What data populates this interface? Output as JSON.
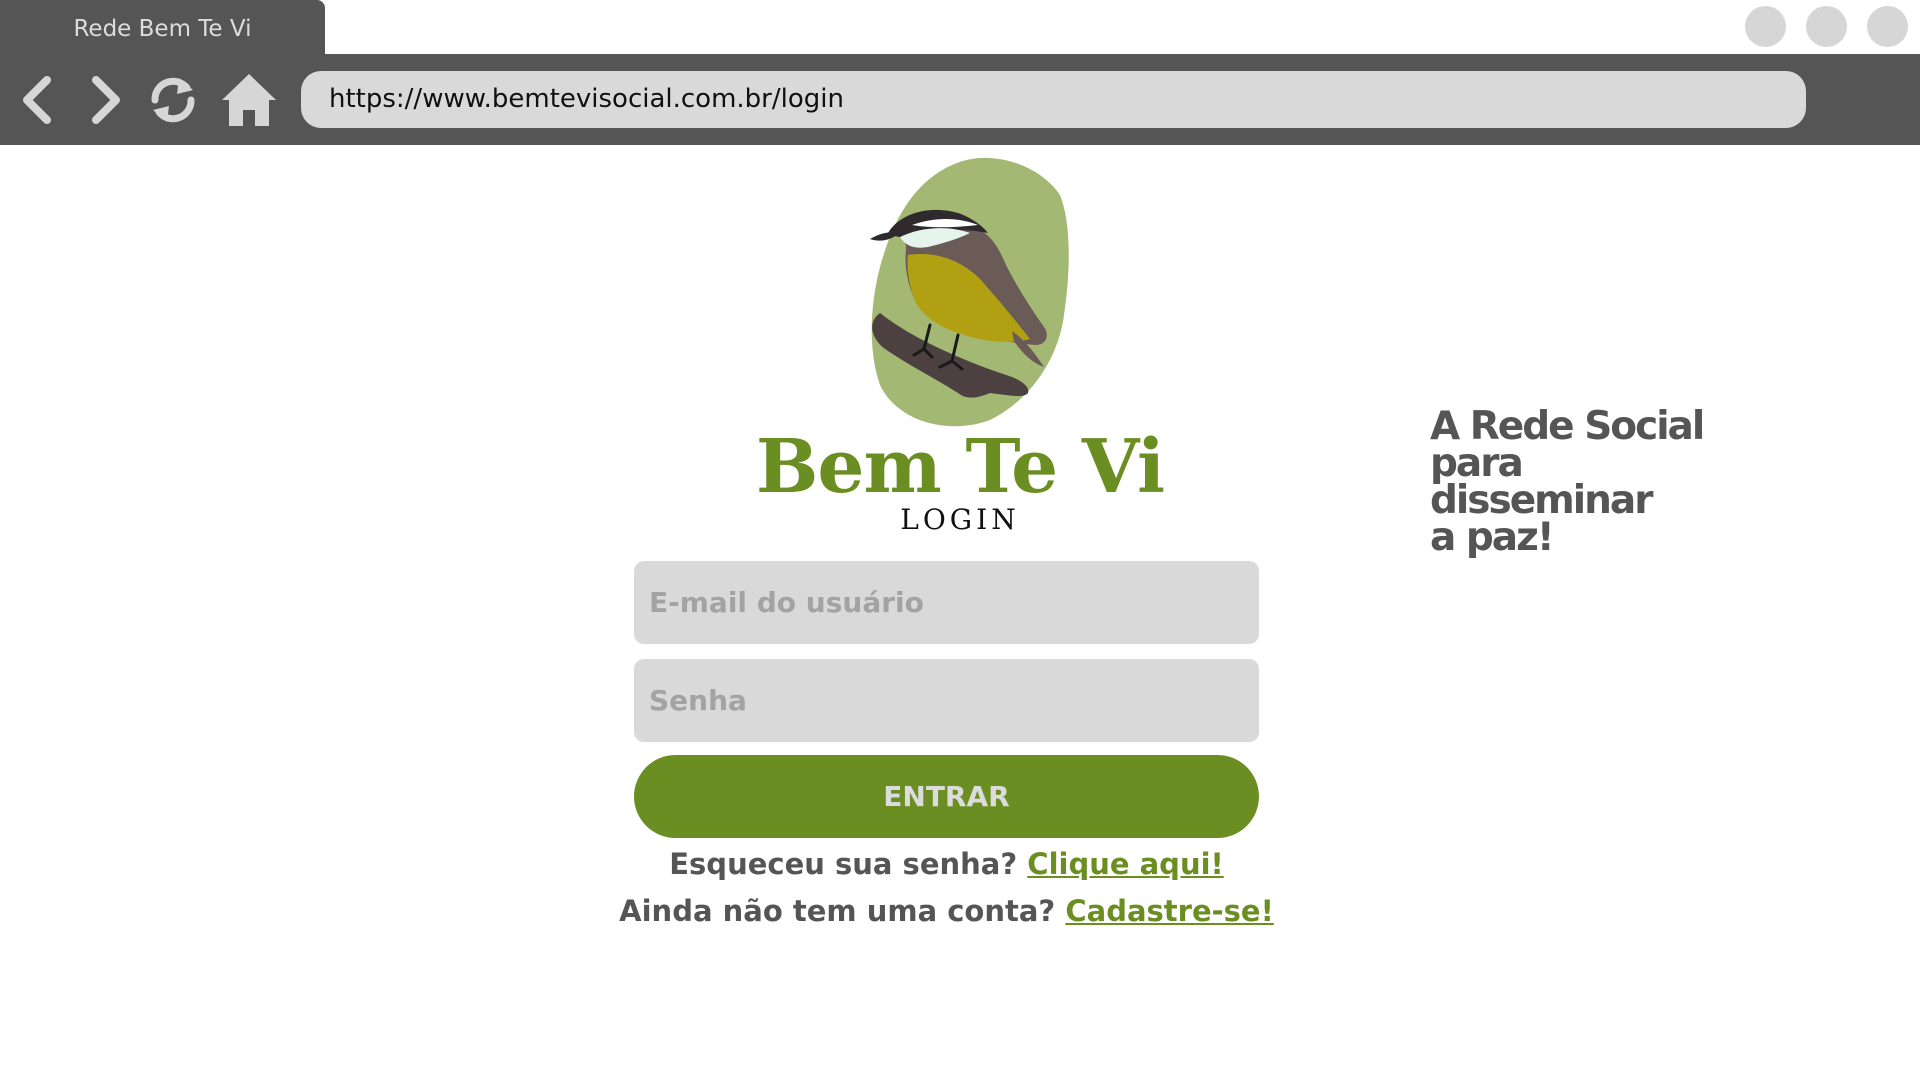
{
  "browser": {
    "tab_title": "Rede Bem Te Vi",
    "address_url": "https://www.bemtevisocial.com.br/login",
    "nav_icons": [
      "back-icon",
      "forward-icon",
      "reload-icon",
      "home-icon"
    ],
    "window_buttons": 3
  },
  "brand": {
    "name": "Bem Te Vi",
    "subtitle": "LOGIN",
    "logo_icon": "bem-te-vi-bird-logo",
    "color": "#6b8e23"
  },
  "tagline": {
    "lines": [
      "A Rede Social",
      "para",
      "disseminar",
      "a paz!"
    ]
  },
  "form": {
    "email_placeholder": "E-mail do usuário",
    "password_placeholder": "Senha",
    "submit_label": "ENTRAR"
  },
  "help": {
    "forgot_text": "Esqueceu sua senha?",
    "forgot_link": "Clique aqui!",
    "signup_text": "Ainda não tem uma conta?",
    "signup_link": "Cadastre-se!"
  },
  "colors": {
    "chrome": "#555555",
    "field_background": "#d9d9d9",
    "accent": "#6b8e23",
    "text_dark": "#555555"
  }
}
